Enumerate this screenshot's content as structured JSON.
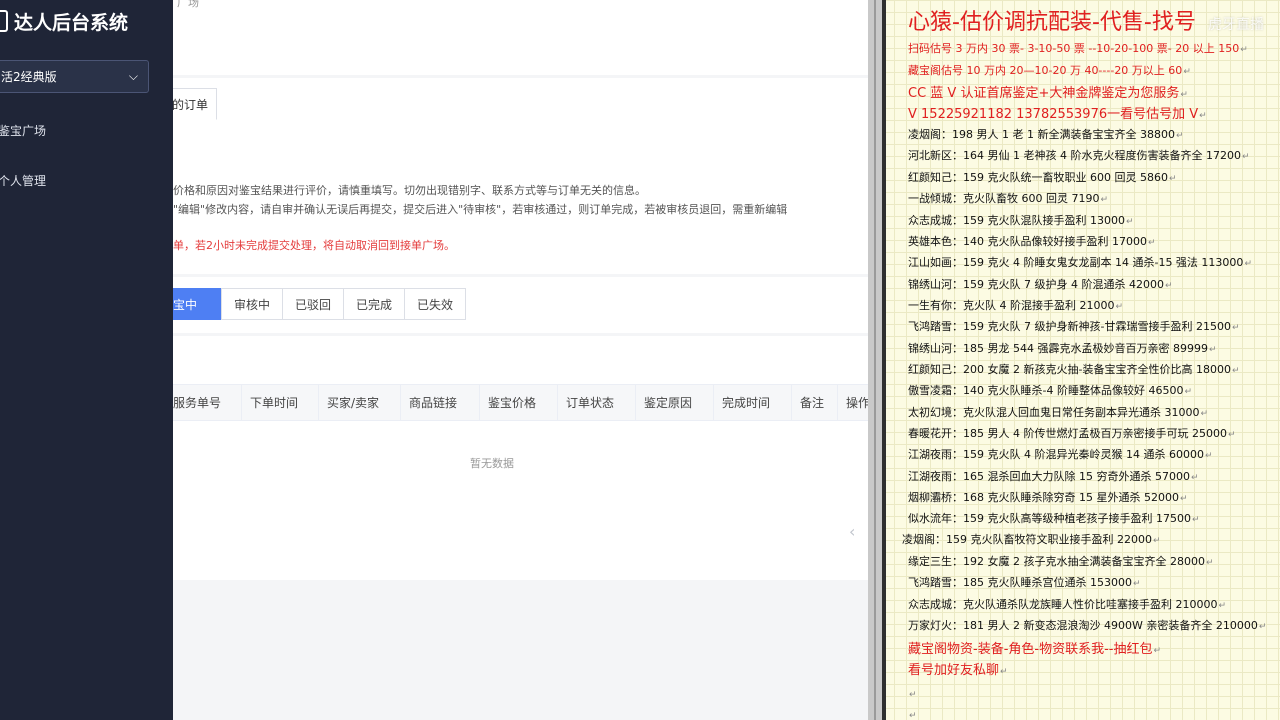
{
  "sidebar": {
    "app_title": "达人后台系统",
    "version_select": "活2经典版",
    "nav": [
      {
        "label": "鉴宝广场"
      },
      {
        "label": "个人管理"
      }
    ]
  },
  "main": {
    "breadcrumb": "广场",
    "tab_label": "的订单",
    "notice_1": "价格和原因对鉴宝结果进行评价，请慎重填写。切勿出现错别字、联系方式等与订单无关的信息。",
    "notice_2": "\"编辑\"修改内容，请自审并确认无误后再提交，提交后进入\"待审核\"，若审核通过，则订单完成，若被审核员退回，需重新编辑",
    "notice_red": "单，若2小时未完成提交处理，将自动取消回到接单广场。",
    "status_tabs": [
      "宝中",
      "审核中",
      "已驳回",
      "已完成",
      "已失效"
    ],
    "table_headers": [
      "服务单号",
      "下单时间",
      "买家/卖家",
      "商品链接",
      "鉴宝价格",
      "订单状态",
      "鉴定原因",
      "完成时间",
      "备注",
      "操作"
    ],
    "empty_text": "暂无数据"
  },
  "doc": {
    "title": "心猿-估价调抗配装-代售-找号",
    "watermark": "虎牙直播",
    "red_lines": [
      "扫码估号 3 万内 30 票- 3-10-50 票   --10-20-100 票- 20 以上 150",
      "藏宝阁估号 10 万内 20—10-20 万 40----20 万以上 60",
      "CC 蓝 V 认证首席鉴定+大神金牌鉴定为您服务",
      "V 15225921182      13782553976一看号估号加 V"
    ],
    "listings": [
      "凌烟阁：198 男人 1 老 1 新全满装备宝宝齐全 38800",
      "河北新区：164 男仙 1 老神孩 4 阶水克火程度伤害装备齐全 17200",
      "红颜知己：159 克火队统一畜牧职业 600 回灵 5860",
      "一战倾城：克火队畜牧 600 回灵 7190",
      "众志成城：159 克火队混队接手盈利 13000",
      "英雄本色：140 克火队品像较好接手盈利 17000",
      "江山如画：159 克火 4 阶睡女鬼女龙副本 14 通杀-15 强法 113000",
      "锦绣山河：159 克火队 7 级护身 4 阶混通杀 42000",
      "一生有你：克火队 4 阶混接手盈利 21000",
      "飞鸿踏雪：159 克火队 7 级护身新神孩-甘霖瑞雪接手盈利 21500",
      "锦绣山河：185 男龙 544 强霹克水孟极妙音百万亲密 89999",
      "红颜知己：200 女魔 2 新孩克火抽-装备宝宝齐全性价比高 18000",
      "傲雪凌霜：140 克火队睡杀-4 阶睡整体品像较好 46500",
      "太初幻境：克火队混人回血鬼日常任务副本异光通杀 31000",
      "春暖花开：185 男人 4 阶传世燃灯孟极百万亲密接手可玩 25000",
      "江湖夜雨：159 克火队 4 阶混异光秦岭灵猴 14 通杀 60000",
      "江湖夜雨：165 混杀回血大力队除 15 穷奇外通杀 57000",
      "烟柳灞桥：168 克火队睡杀除穷奇 15 星外通杀 52000",
      "似水流年：159 克火队高等级种植老孩子接手盈利 17500",
      "凌烟阁：159 克火队畜牧符文职业接手盈利 22000",
      "缘定三生：192 女魔 2 孩子克水抽全满装备宝宝齐全 28000",
      "飞鸿踏雪：185 克火队睡杀宫位通杀 153000",
      "众志成城：克火队通杀队龙族睡人性价比哇塞接手盈利 210000",
      "万家灯火：181 男人 2 新变态混浪淘沙 4900W 亲密装备齐全 210000"
    ],
    "footer_red": [
      "藏宝阁物资-装备-角色-物资联系我--抽红包",
      "看号加好友私聊"
    ],
    "colors": {
      "red": "#e02020",
      "accent_blue": "#4e7ff3",
      "sidebar_bg": "#1f2537"
    }
  }
}
